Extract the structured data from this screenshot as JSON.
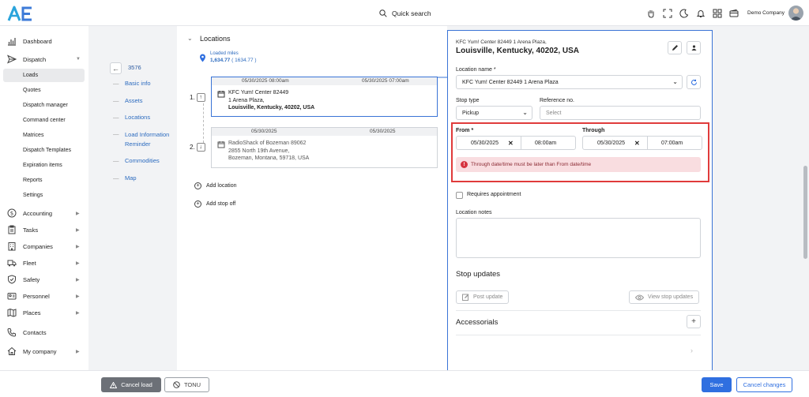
{
  "header": {
    "search_label": "Quick search",
    "company_name": "Demo Company",
    "icons": [
      "hand-icon",
      "fullscreen-icon",
      "moon-icon",
      "bell-icon",
      "apps-grid-icon",
      "wallet-icon"
    ]
  },
  "sidebar": {
    "items": [
      {
        "label": "Dashboard",
        "icon": "bar-chart-icon"
      },
      {
        "label": "Dispatch",
        "icon": "send-icon",
        "expanded": true
      },
      {
        "label": "Accounting",
        "icon": "dollar-icon"
      },
      {
        "label": "Tasks",
        "icon": "clipboard-icon"
      },
      {
        "label": "Companies",
        "icon": "building-icon"
      },
      {
        "label": "Fleet",
        "icon": "truck-icon"
      },
      {
        "label": "Safety",
        "icon": "shield-icon"
      },
      {
        "label": "Personnel",
        "icon": "id-card-icon"
      },
      {
        "label": "Places",
        "icon": "map-icon"
      },
      {
        "label": "Contacts",
        "icon": "phone-icon"
      },
      {
        "label": "My company",
        "icon": "home-icon"
      }
    ],
    "dispatch_sub": [
      "Loads",
      "Quotes",
      "Dispatch manager",
      "Command center",
      "Matrices",
      "Dispatch Templates",
      "Expiration items",
      "Reports",
      "Settings"
    ]
  },
  "subnav": {
    "load_number": "3576",
    "items": [
      "Basic info",
      "Assets",
      "Locations",
      "Load Information",
      "Reminder",
      "Commodities",
      "Map"
    ]
  },
  "locations": {
    "title": "Locations",
    "loaded_miles_label": "Loaded miles",
    "loaded_miles_value": "1,634.77",
    "loaded_miles_paren": "( 1634.77 )",
    "stops": [
      {
        "num": "1.",
        "date_from": "05/30/2025 08:00am",
        "date_to": "05/30/2025 07:00am",
        "name": "KFC Yum! Center 82449",
        "line2": "1 Arena Plaza,",
        "line3": "Louisville, Kentucky, 40202, USA"
      },
      {
        "num": "2.",
        "date_from": "05/30/2025",
        "date_to": "05/30/2025",
        "name": "RadioShack of Bozeman 89062",
        "line2": "2855 North 19th Avenue,",
        "line3": "Bozeman, Montana, 59718, USA"
      }
    ],
    "add_location": "Add location",
    "add_stop_off": "Add stop off"
  },
  "form": {
    "address_small": "KFC Yum! Center 82449 1 Arena Plaza,",
    "address_large": "Louisville, Kentucky, 40202, USA",
    "location_name_label": "Location name *",
    "location_name_value": "KFC Yum! Center 82449 1 Arena Plaza",
    "stop_type_label": "Stop type",
    "stop_type_value": "Pickup",
    "reference_label": "Reference no.",
    "reference_placeholder": "Select",
    "from_label": "From *",
    "from_date": "05/30/2025",
    "from_time": "08:00am",
    "through_label": "Through",
    "through_date": "05/30/2025",
    "through_time": "07:00am",
    "error_message": "Through date/time must be later than From date/time",
    "requires_appointment": "Requires appointment",
    "location_notes_label": "Location notes",
    "stop_updates_title": "Stop updates",
    "post_update": "Post update",
    "view_stop_updates": "View stop updates",
    "accessorials_title": "Accessorials"
  },
  "footer": {
    "cancel_load": "Cancel load",
    "tonu": "TONU",
    "save": "Save",
    "cancel_changes": "Cancel changes"
  },
  "colors": {
    "accent": "#2f6fe0",
    "error": "#e03b3b",
    "error_bg": "#f9dde0",
    "link": "#2c6bbf"
  }
}
